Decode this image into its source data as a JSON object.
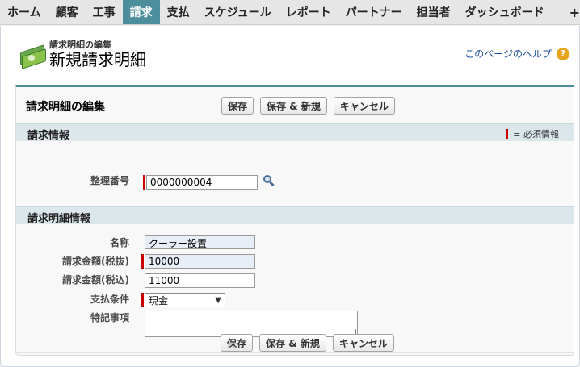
{
  "tabs": [
    {
      "label": "ホーム"
    },
    {
      "label": "顧客"
    },
    {
      "label": "工事"
    },
    {
      "label": "請求",
      "active": true
    },
    {
      "label": "支払"
    },
    {
      "label": "スケジュール"
    },
    {
      "label": "レポート"
    },
    {
      "label": "パートナー"
    },
    {
      "label": "担当者"
    },
    {
      "label": "ダッシュボード"
    }
  ],
  "tab_plus": "+",
  "header": {
    "subtitle": "請求明細の編集",
    "title": "新規請求明細",
    "help_link": "このページのヘルプ",
    "help_icon": "?"
  },
  "form": {
    "title": "請求明細の編集",
    "buttons": {
      "save": "保存",
      "save_new": "保存 & 新規",
      "cancel": "キャンセル"
    },
    "sections": {
      "invoice": "請求情報",
      "detail": "請求明細情報"
    },
    "required_legend": "= 必須情報",
    "fields": {
      "seiri_label": "整理番号",
      "seiri_value": "0000000004",
      "name_label": "名称",
      "name_value": "クーラー設置",
      "amount_ex_label": "請求金額(税抜)",
      "amount_ex_value": "10000",
      "amount_in_label": "請求金額(税込)",
      "amount_in_value": "11000",
      "payment_label": "支払条件",
      "payment_value": "現金",
      "notes_label": "特記事項",
      "notes_value": ""
    }
  },
  "colors": {
    "accent": "#4d8e9c",
    "required": "#cc0000",
    "help": "#1f4f9b"
  },
  "icons": {
    "header": "money-icon",
    "lookup": "lookup-icon",
    "help": "help-icon"
  }
}
